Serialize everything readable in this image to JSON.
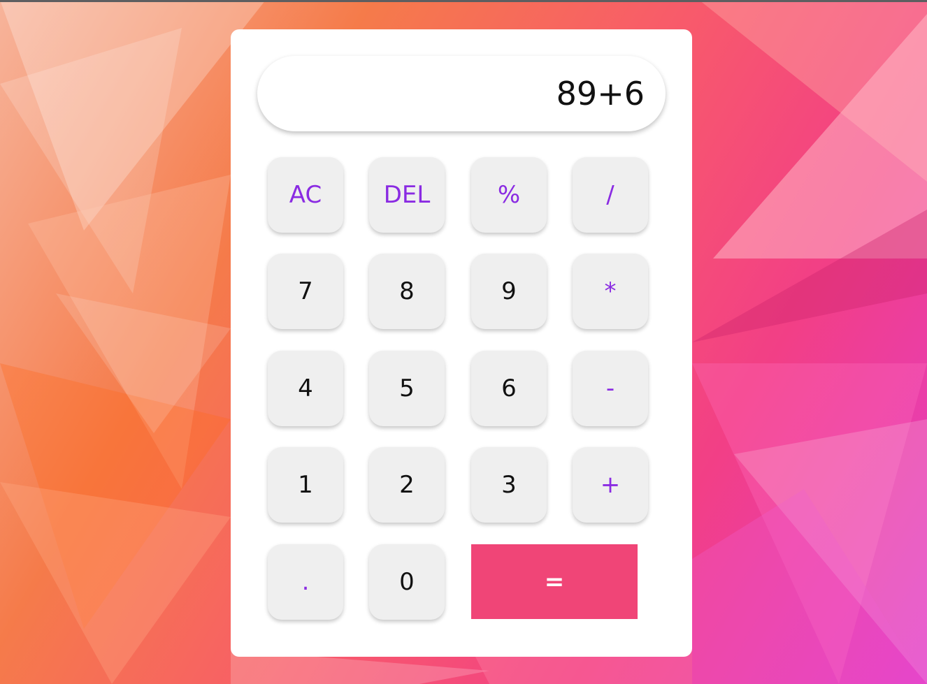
{
  "display": {
    "value": "89+6"
  },
  "keys": {
    "ac": "AC",
    "del": "DEL",
    "percent": "%",
    "divide": "/",
    "seven": "7",
    "eight": "8",
    "nine": "9",
    "multiply": "*",
    "four": "4",
    "five": "5",
    "six": "6",
    "minus": "-",
    "one": "1",
    "two": "2",
    "three": "3",
    "plus": "+",
    "dot": ".",
    "zero": "0",
    "equals": "="
  },
  "colors": {
    "operator_text": "#8a2be2",
    "equals_bg": "#f04577",
    "key_bg": "#efefef",
    "panel_bg": "#ffffff"
  }
}
